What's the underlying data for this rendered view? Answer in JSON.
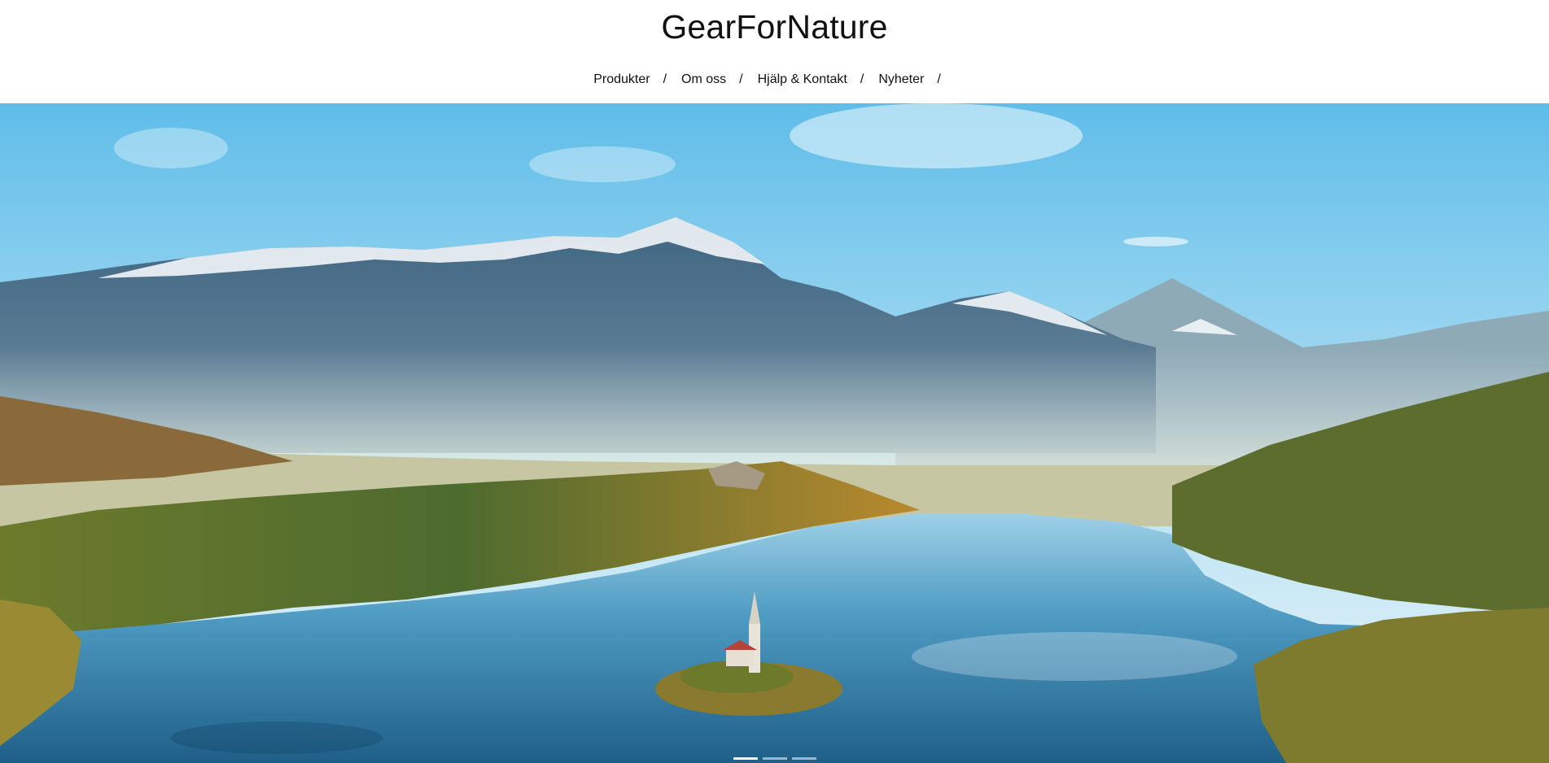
{
  "site": {
    "title": "GearForNature"
  },
  "nav": {
    "items": [
      {
        "label": "Produkter",
        "separator": "/"
      },
      {
        "label": "Om oss",
        "separator": "/"
      },
      {
        "label": "Hjälp & Kontakt",
        "separator": "/"
      },
      {
        "label": "Nyheter",
        "separator": "/"
      }
    ]
  },
  "hero": {
    "image": "mountain-lake-with-island-church",
    "slide_count": 3,
    "active_slide": 1
  },
  "colors": {
    "sky": "#8fd0f0",
    "snow": "#f2f6fa",
    "mountain": "#4f7390",
    "lake": "#2f78a3",
    "forest": "#6b7a2f",
    "autumn": "#c98a2a"
  }
}
